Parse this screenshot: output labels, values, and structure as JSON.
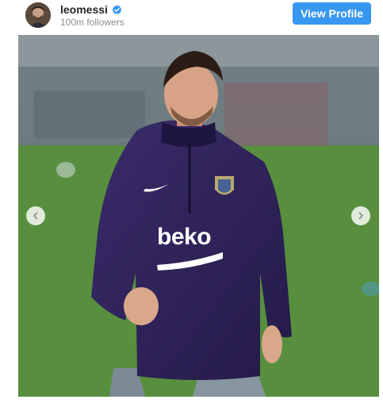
{
  "header": {
    "username": "leomessi",
    "verified": true,
    "followers": "100m followers",
    "view_profile_label": "View Profile",
    "avatar_icon": "profile-avatar"
  },
  "media": {
    "jersey_text": "beko",
    "nav_prev_icon": "chevron-left-icon",
    "nav_next_icon": "chevron-right-icon"
  },
  "colors": {
    "accent": "#3897f0",
    "verified": "#3897f0",
    "username": "#262626",
    "secondary_text": "#8e8e8e"
  }
}
